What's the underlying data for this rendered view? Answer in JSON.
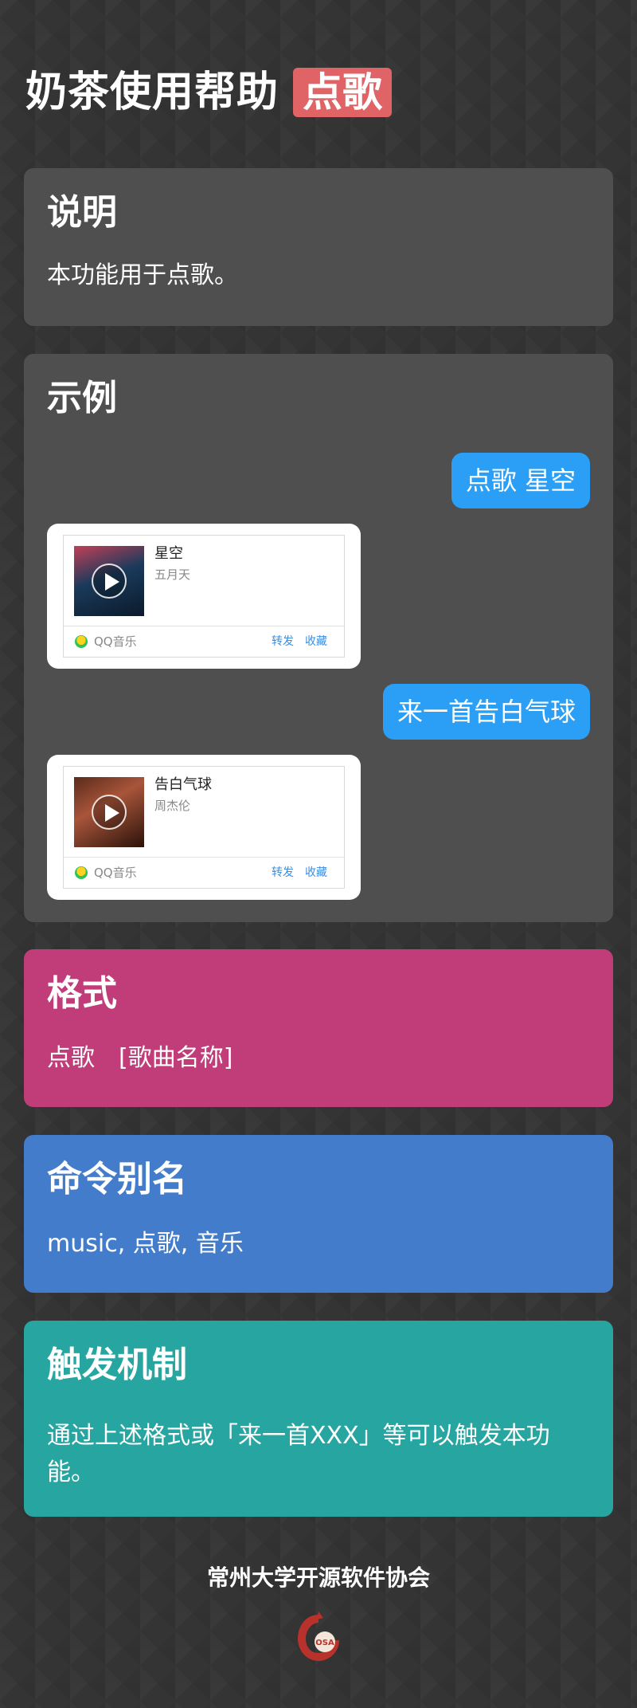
{
  "header": {
    "title": "奶茶使用帮助",
    "tag": "点歌"
  },
  "description": {
    "heading": "说明",
    "text": "本功能用于点歌。"
  },
  "example": {
    "heading": "示例",
    "messages": [
      {
        "bubble": "点歌 星空",
        "card": {
          "title": "星空",
          "artist": "五月天",
          "source": "QQ音乐",
          "forward": "转发",
          "favorite": "收藏"
        }
      },
      {
        "bubble": "来一首告白气球",
        "card": {
          "title": "告白气球",
          "artist": "周杰伦",
          "source": "QQ音乐",
          "forward": "转发",
          "favorite": "收藏"
        }
      }
    ]
  },
  "format": {
    "heading": "格式",
    "text": "点歌　[歌曲名称]"
  },
  "alias": {
    "heading": "命令别名",
    "text": "music, 点歌, 音乐"
  },
  "trigger": {
    "heading": "触发机制",
    "text": "通过上述格式或「来一首XXX」等可以触发本功能。"
  },
  "footer": {
    "org": "常州大学开源软件协会",
    "logo_text": "OSA"
  },
  "colors": {
    "background": "#343434",
    "card_gray": "#4f4f4f",
    "format": "#c03d79",
    "alias": "#427ccb",
    "trigger": "#27a6a1",
    "bubble": "#2b9ff5",
    "tag": "#e06466"
  }
}
